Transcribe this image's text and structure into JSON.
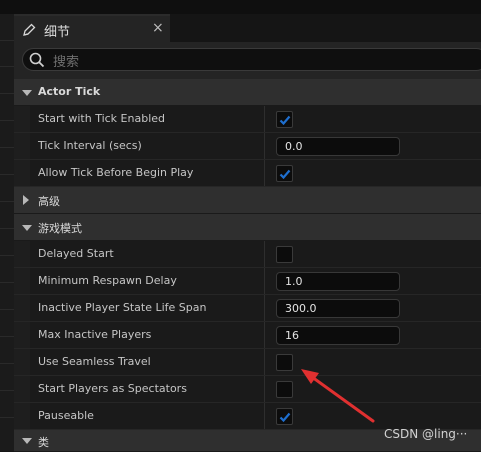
{
  "panel": {
    "tab_title": "细节",
    "close_glyph": "×",
    "search_placeholder": "搜索"
  },
  "sections": {
    "actor_tick": {
      "label": "Actor Tick",
      "rows": {
        "start_with_tick": {
          "label": "Start with Tick Enabled",
          "checked": true
        },
        "tick_interval": {
          "label": "Tick Interval (secs)",
          "value": "0.0"
        },
        "allow_tick": {
          "label": "Allow Tick Before Begin Play",
          "checked": true
        }
      }
    },
    "advanced": {
      "label": "高级"
    },
    "game_mode": {
      "label": "游戏模式",
      "rows": {
        "delayed_start": {
          "label": "Delayed Start",
          "checked": false
        },
        "min_respawn_delay": {
          "label": "Minimum Respawn Delay",
          "value": "1.0"
        },
        "inactive_lifespan": {
          "label": "Inactive Player State Life Span",
          "value": "300.0"
        },
        "max_inactive": {
          "label": "Max Inactive Players",
          "value": "16"
        },
        "seamless_travel": {
          "label": "Use Seamless Travel",
          "checked": false
        },
        "start_spectators": {
          "label": "Start Players as Spectators",
          "checked": false
        },
        "pauseable": {
          "label": "Pauseable",
          "checked": true
        }
      }
    },
    "class": {
      "label": "类"
    }
  },
  "annotation": {
    "color": "#e03030"
  },
  "watermark": "CSDN @ling···",
  "colors": {
    "accent": "#1e6fd0",
    "checkmark": "#ffffff"
  },
  "icons": {
    "tab": "details-pencil-icon",
    "search": "search-icon"
  }
}
